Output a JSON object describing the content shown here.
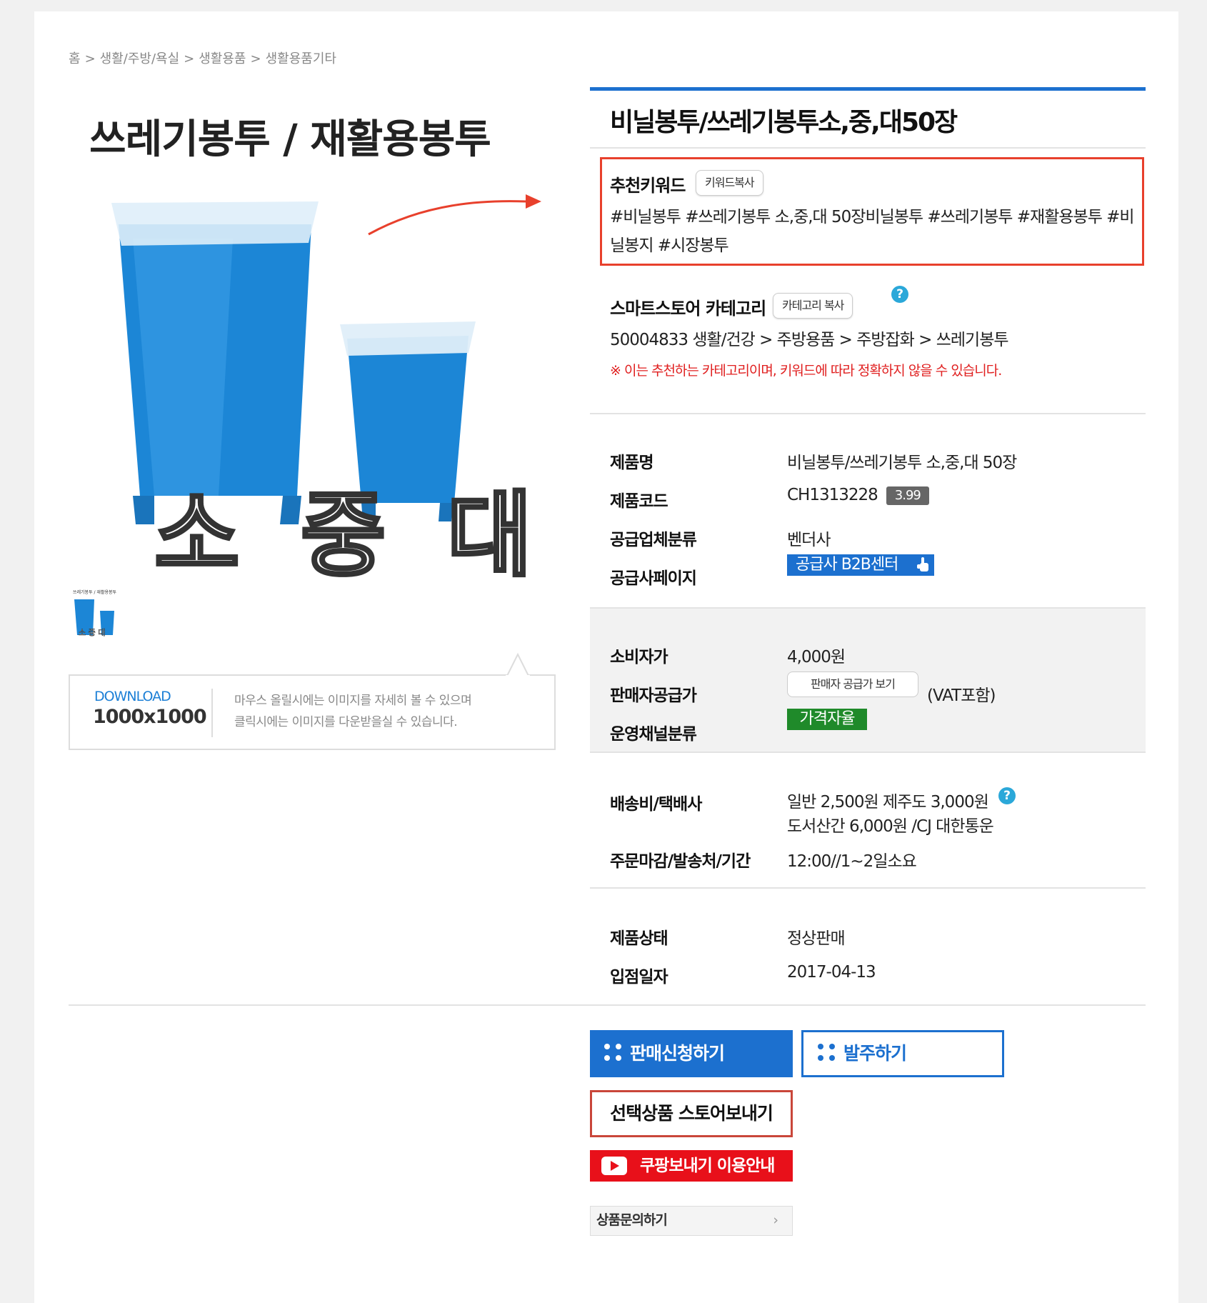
{
  "breadcrumb": {
    "items": [
      "홈",
      "생활/주방/욕실",
      "생활용품",
      "생활용품기타"
    ],
    "separator": ">"
  },
  "image": {
    "title": "쓰레기봉투 / 재활용봉투",
    "sizes": "소 중 대",
    "thumb_title": "쓰레기봉투 / 재활용봉투",
    "thumb_sizes": "소 중 대"
  },
  "download": {
    "label": "DOWNLOAD",
    "size": "1000x1000",
    "desc_line1": "마우스 올릴시에는 이미지를 자세히 볼 수 있으며",
    "desc_line2": "클릭시에는 이미지를 다운받을실 수 있습니다."
  },
  "product": {
    "title": "비닐봉투/쓰레기봉투소,중,대50장"
  },
  "keywords": {
    "title": "추천키워드",
    "copy_button": "키워드복사",
    "text": "#비닐봉투 #쓰레기봉투 소,중,대 50장비닐봉투 #쓰레기봉투 #재활용봉투 #비닐봉지 #시장봉투"
  },
  "category": {
    "title": "스마트스토어 카테고리",
    "copy_button": "카테고리 복사",
    "help": "?",
    "path": "50004833 생활/건강 > 주방용품 > 주방잡화 > 쓰레기봉투",
    "note": "※ 이는 추천하는 카테고리이며, 키워드에 따라 정확하지 않을 수 있습니다."
  },
  "info": {
    "name_label": "제품명",
    "name_value": "비닐봉투/쓰레기봉투 소,중,대 50장",
    "code_label": "제품코드",
    "code_value": "CH1313228",
    "code_badge": "3.99",
    "supplier_type_label": "공급업체분류",
    "supplier_type_value": "벤더사",
    "supplier_page_label": "공급사페이지",
    "supplier_page_button": "공급사 B2B센터"
  },
  "price": {
    "consumer_label": "소비자가",
    "consumer_value": "4,000원",
    "seller_label": "판매자공급가",
    "seller_button": "판매자 공급가 보기",
    "seller_vat": "(VAT포함)",
    "channel_label": "운영채널분류",
    "channel_value": "가격자율"
  },
  "shipping": {
    "fee_label": "배송비/택배사",
    "fee_line1": "일반 2,500원 제주도 3,000원",
    "fee_line2": "도서산간 6,000원 /CJ 대한통운",
    "help": "?",
    "deadline_label": "주문마감/발송처/기간",
    "deadline_value": "12:00//1~2일소요"
  },
  "status": {
    "state_label": "제품상태",
    "state_value": "정상판매",
    "date_label": "입점일자",
    "date_value": "2017-04-13"
  },
  "actions": {
    "apply": "판매신청하기",
    "order": "발주하기",
    "store": "선택상품 스토어보내기",
    "coupang": "쿠팡보내기 이용안내",
    "qna": "상품문의하기",
    "qna_chevron": "›"
  },
  "colors": {
    "brand_blue": "#1c70cf",
    "highlight_red": "#e8402c",
    "warning_red": "#e02020",
    "channel_green": "#1f8a2a",
    "coupang_red": "#e8101a",
    "help_cyan": "#2ba8d9"
  }
}
